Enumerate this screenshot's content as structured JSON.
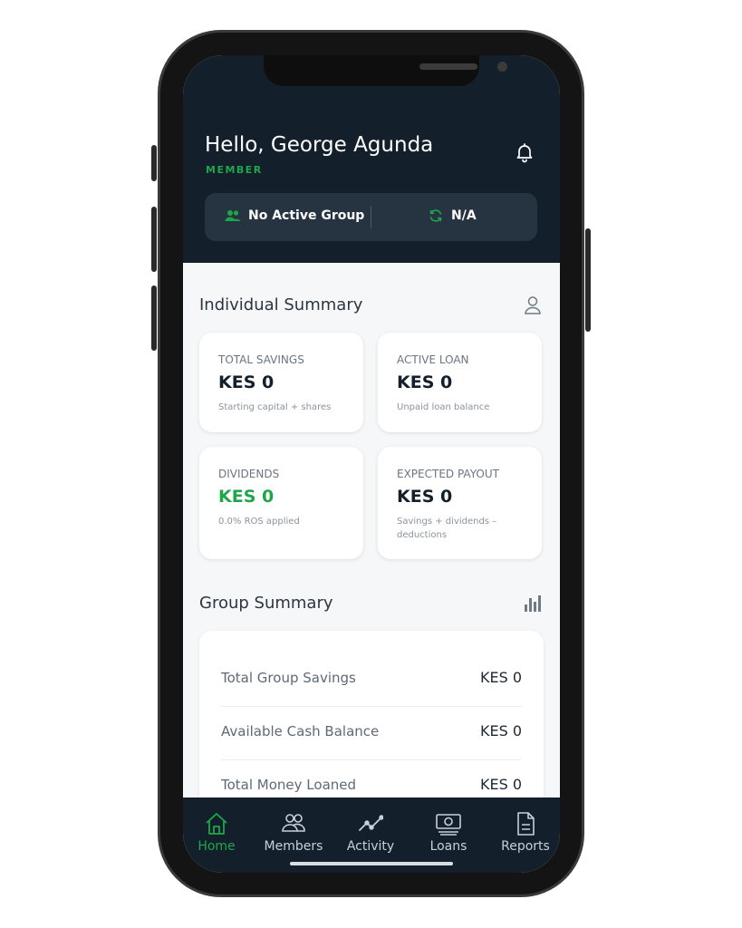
{
  "header": {
    "greeting": "Hello, George Agunda",
    "role": "MEMBER",
    "group_name": "No Active Group",
    "group_status": "N/A"
  },
  "individual_summary": {
    "title": "Individual Summary",
    "cards": [
      {
        "label": "TOTAL SAVINGS",
        "value": "KES 0",
        "note": "Starting capital + shares"
      },
      {
        "label": "ACTIVE LOAN",
        "value": "KES 0",
        "note": "Unpaid loan balance"
      },
      {
        "label": "DIVIDENDS",
        "value": "KES 0",
        "note": "0.0% ROS applied"
      },
      {
        "label": "EXPECTED PAYOUT",
        "value": "KES 0",
        "note": "Savings + dividends – deductions"
      }
    ]
  },
  "group_summary": {
    "title": "Group Summary",
    "rows": [
      {
        "label": "Total Group Savings",
        "value": "KES 0"
      },
      {
        "label": "Available Cash Balance",
        "value": "KES 0"
      },
      {
        "label": "Total Money Loaned",
        "value": "KES 0"
      }
    ]
  },
  "tabs": [
    {
      "label": "Home",
      "icon": "home-icon",
      "active": true
    },
    {
      "label": "Members",
      "icon": "members-icon",
      "active": false
    },
    {
      "label": "Activity",
      "icon": "activity-icon",
      "active": false
    },
    {
      "label": "Loans",
      "icon": "loans-icon",
      "active": false
    },
    {
      "label": "Reports",
      "icon": "reports-icon",
      "active": false
    }
  ],
  "colors": {
    "accent": "#1fa64a",
    "header_bg": "#13202c",
    "screen_bg": "#f5f7f9"
  }
}
